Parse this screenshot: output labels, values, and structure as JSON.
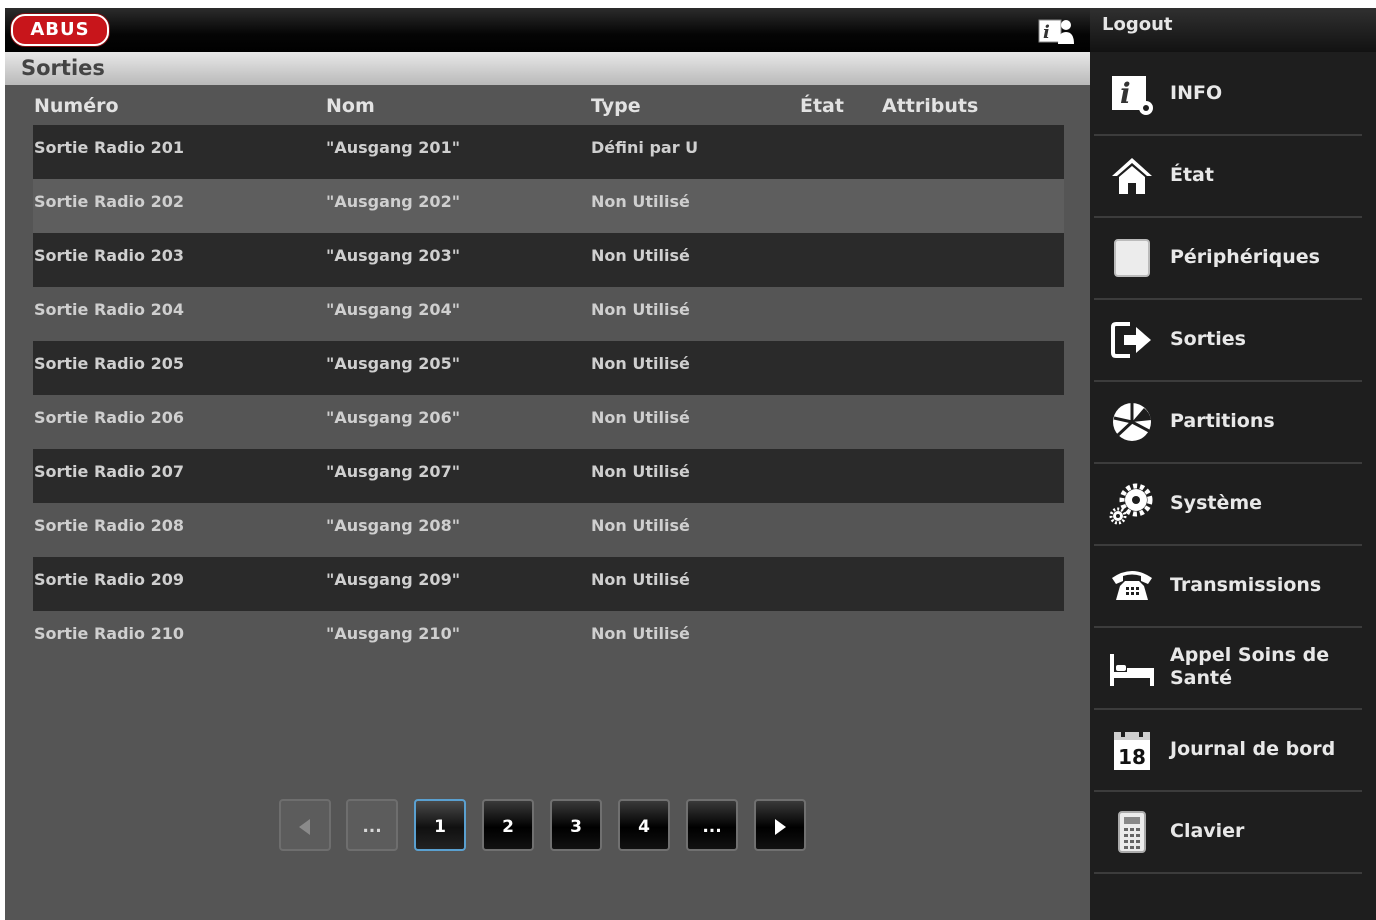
{
  "brand": {
    "logo_text": "ABUS"
  },
  "header": {
    "logout_label": "Logout"
  },
  "page": {
    "title": "Sorties"
  },
  "table": {
    "columns": [
      "Numéro",
      "Nom",
      "Type",
      "État",
      "Attributs"
    ],
    "rows": [
      {
        "numero": "Sortie Radio 201",
        "nom": "\"Ausgang 201\"",
        "type": "Défini par U"
      },
      {
        "numero": "Sortie Radio 202",
        "nom": "\"Ausgang 202\"",
        "type": "Non Utilisé"
      },
      {
        "numero": "Sortie Radio 203",
        "nom": "\"Ausgang 203\"",
        "type": "Non Utilisé"
      },
      {
        "numero": "Sortie Radio 204",
        "nom": "\"Ausgang 204\"",
        "type": "Non Utilisé"
      },
      {
        "numero": "Sortie Radio 205",
        "nom": "\"Ausgang 205\"",
        "type": "Non Utilisé"
      },
      {
        "numero": "Sortie Radio 206",
        "nom": "\"Ausgang 206\"",
        "type": "Non Utilisé"
      },
      {
        "numero": "Sortie Radio 207",
        "nom": "\"Ausgang 207\"",
        "type": "Non Utilisé"
      },
      {
        "numero": "Sortie Radio 208",
        "nom": "\"Ausgang 208\"",
        "type": "Non Utilisé"
      },
      {
        "numero": "Sortie Radio 209",
        "nom": "\"Ausgang 209\"",
        "type": "Non Utilisé"
      },
      {
        "numero": "Sortie Radio 210",
        "nom": "\"Ausgang 210\"",
        "type": "Non Utilisé"
      }
    ]
  },
  "pagination": {
    "prev_icon": "arrow-left-icon",
    "next_icon": "arrow-right-icon",
    "ellipsis_left": "...",
    "pages": [
      "1",
      "2",
      "3",
      "4"
    ],
    "ellipsis_right": "...",
    "current_page": "1"
  },
  "sidebar": {
    "items": [
      {
        "label": "INFO",
        "icon": "info-icon"
      },
      {
        "label": "État",
        "icon": "home-icon"
      },
      {
        "label": "Périphériques",
        "icon": "device-icon"
      },
      {
        "label": "Sorties",
        "icon": "exit-icon"
      },
      {
        "label": "Partitions",
        "icon": "partitions-icon"
      },
      {
        "label": "Système",
        "icon": "gears-icon"
      },
      {
        "label": "Transmissions",
        "icon": "telephone-icon"
      },
      {
        "label": "Appel Soins de Santé",
        "icon": "bed-icon"
      },
      {
        "label": "Journal de bord",
        "icon": "calendar-icon",
        "icon_text": "18"
      },
      {
        "label": "Clavier",
        "icon": "keypad-icon"
      }
    ]
  }
}
